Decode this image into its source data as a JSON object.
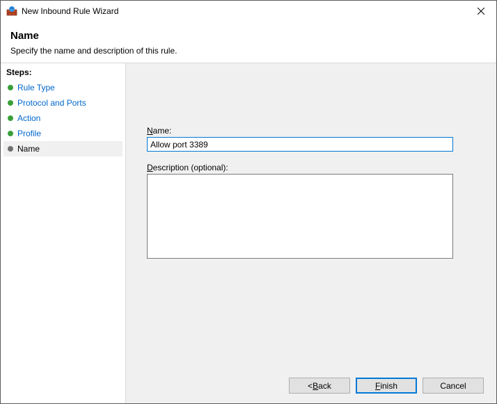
{
  "window": {
    "title": "New Inbound Rule Wizard",
    "close_tooltip": "Close"
  },
  "header": {
    "title": "Name",
    "subtitle": "Specify the name and description of this rule."
  },
  "sidebar": {
    "heading": "Steps:",
    "items": [
      {
        "label": "Rule Type",
        "current": false
      },
      {
        "label": "Protocol and Ports",
        "current": false
      },
      {
        "label": "Action",
        "current": false
      },
      {
        "label": "Profile",
        "current": false
      },
      {
        "label": "Name",
        "current": true
      }
    ]
  },
  "form": {
    "name_label_pre": "N",
    "name_label_post": "ame:",
    "name_value": "Allow port 3389",
    "desc_label_pre": "D",
    "desc_label_post": "escription (optional):",
    "desc_value": ""
  },
  "buttons": {
    "back_pre": "< ",
    "back_ul": "B",
    "back_post": "ack",
    "finish_pre": "",
    "finish_ul": "F",
    "finish_post": "inish",
    "cancel": "Cancel"
  }
}
